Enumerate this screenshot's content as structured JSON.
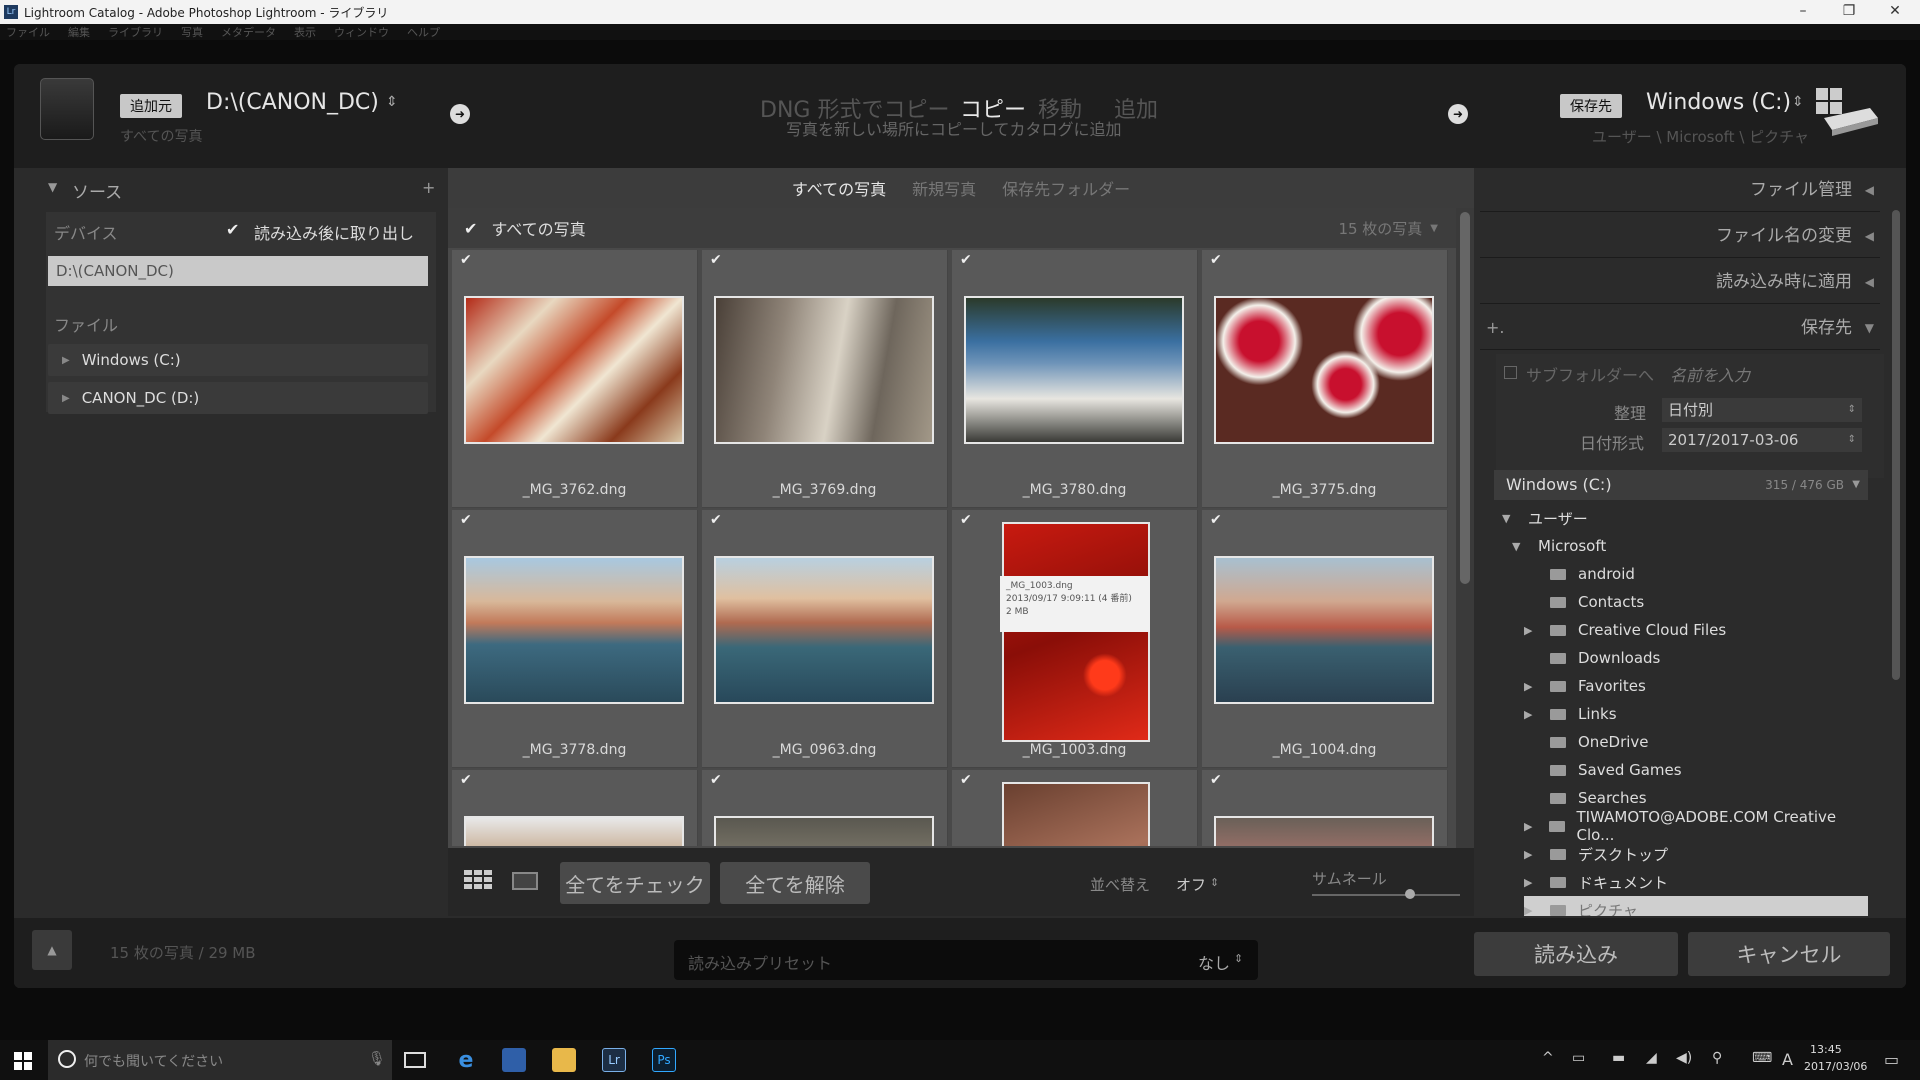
{
  "app": {
    "title": "Lightroom Catalog - Adobe Photoshop Lightroom - ライブラリ",
    "menu": [
      "ファイル",
      "編集",
      "ライブラリ",
      "写真",
      "メタデータ",
      "表示",
      "ウィンドウ",
      "ヘルプ"
    ]
  },
  "header": {
    "source_badge": "追加元",
    "source_path": "D:\\(CANON_DC)",
    "source_sub": "すべての写真",
    "modes": [
      "DNG 形式でコピー",
      "コピー",
      "移動",
      "追加"
    ],
    "mode_desc": "写真を新しい場所にコピーしてカタログに追加",
    "dest_badge": "保存先",
    "dest_name": "Windows (C:)",
    "dest_path": "ユーザー \\ Microsoft \\ ピクチャ"
  },
  "left": {
    "source_title": "ソース",
    "devices_label": "デバイス",
    "eject_label": "読み込み後に取り出し",
    "device_item": "D:\\(CANON_DC)",
    "files_label": "ファイル",
    "drives": [
      "Windows (C:)",
      "CANON_DC (D:)"
    ]
  },
  "center": {
    "tabs": [
      "すべての写真",
      "新規写真",
      "保存先フォルダー"
    ],
    "filter_label": "すべての写真",
    "count_label": "15 枚の写真",
    "photos": [
      {
        "name": "_MG_3762.dng"
      },
      {
        "name": "_MG_3769.dng"
      },
      {
        "name": "_MG_3780.dng"
      },
      {
        "name": "_MG_3775.dng"
      },
      {
        "name": "_MG_3778.dng"
      },
      {
        "name": "_MG_0963.dng"
      },
      {
        "name": "_MG_1003.dng"
      },
      {
        "name": "_MG_1004.dng"
      },
      {
        "name": ""
      },
      {
        "name": ""
      },
      {
        "name": ""
      },
      {
        "name": ""
      }
    ],
    "tooltip": {
      "line1": "_MG_1003.dng",
      "line2": "2013/09/17 9:09:11 (4 番前)",
      "line3": "2 MB"
    },
    "check_all": "全てをチェック",
    "uncheck_all": "全てを解除",
    "sort_label": "並べ替え",
    "sort_value": "オフ",
    "thumb_label": "サムネール",
    "thumb_level": 0.66
  },
  "right": {
    "sections": [
      "ファイル管理",
      "ファイル名の変更",
      "読み込み時に適用",
      "保存先"
    ],
    "subfolder_label": "サブフォルダーへ",
    "subfolder_placeholder": "名前を入力",
    "organize_label": "整理",
    "organize_value": "日付別",
    "dateformat_label": "日付形式",
    "dateformat_value": "2017/2017-03-06",
    "volume_name": "Windows (C:)",
    "volume_size": "315 / 476 GB",
    "tree": [
      {
        "label": "ユーザー",
        "level": 0,
        "exp": "▼"
      },
      {
        "label": "Microsoft",
        "level": 1,
        "exp": "▼"
      },
      {
        "label": "android",
        "level": 2,
        "exp": ""
      },
      {
        "label": "Contacts",
        "level": 2,
        "exp": ""
      },
      {
        "label": "Creative Cloud Files",
        "level": 2,
        "exp": "▶"
      },
      {
        "label": "Downloads",
        "level": 2,
        "exp": ""
      },
      {
        "label": "Favorites",
        "level": 2,
        "exp": "▶"
      },
      {
        "label": "Links",
        "level": 2,
        "exp": "▶"
      },
      {
        "label": "OneDrive",
        "level": 2,
        "exp": ""
      },
      {
        "label": "Saved Games",
        "level": 2,
        "exp": ""
      },
      {
        "label": "Searches",
        "level": 2,
        "exp": ""
      },
      {
        "label": "TIWAMOTO@ADOBE.COM Creative Clo...",
        "level": 2,
        "exp": "▶"
      },
      {
        "label": "デスクトップ",
        "level": 2,
        "exp": "▶"
      },
      {
        "label": "ドキュメント",
        "level": 2,
        "exp": "▶"
      },
      {
        "label": "ピクチャ",
        "level": 2,
        "exp": "▶"
      }
    ]
  },
  "footer": {
    "summary": "15 枚の写真 / 29 MB",
    "preset_label": "読み込みプリセット",
    "preset_value": "なし",
    "import_button": "読み込み",
    "cancel_button": "キャンセル"
  },
  "taskbar": {
    "search_placeholder": "何でも聞いてください",
    "time": "13:45",
    "date": "2017/03/06",
    "ime": "A"
  }
}
